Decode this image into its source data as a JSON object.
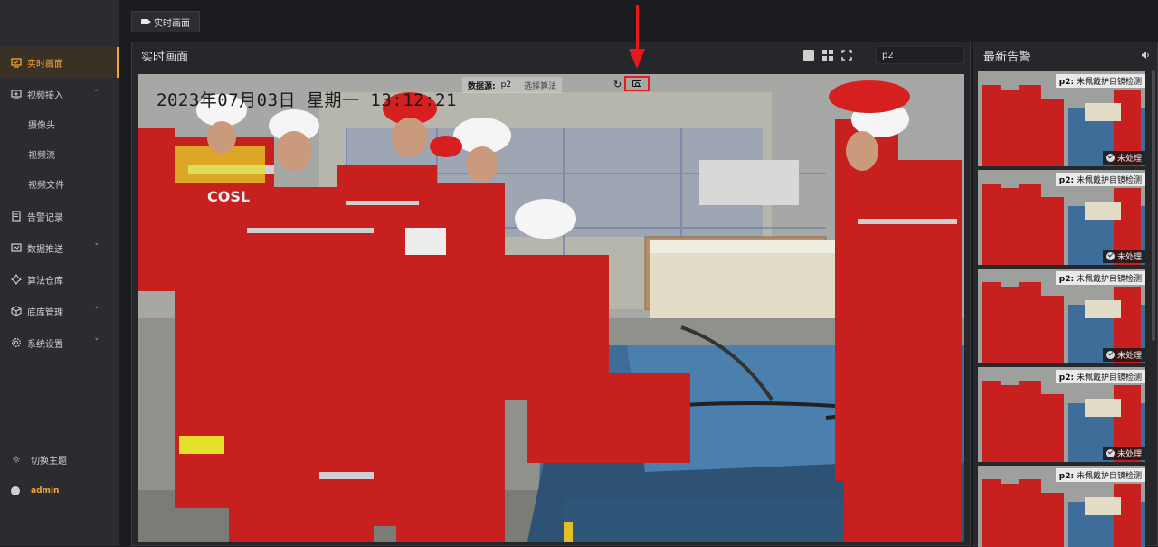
{
  "tab": {
    "label": "实时画面"
  },
  "sidebar": {
    "items": [
      {
        "label": "实时画面",
        "icon": "monitor-icon",
        "active": true
      },
      {
        "label": "视频接入",
        "icon": "video-input-icon",
        "chevron": "˄"
      },
      {
        "label": "告警记录",
        "icon": "alarm-record-icon"
      },
      {
        "label": "数据推送",
        "icon": "data-push-icon",
        "chevron": "˅"
      },
      {
        "label": "算法仓库",
        "icon": "algorithm-icon"
      },
      {
        "label": "底库管理",
        "icon": "library-icon",
        "chevron": "˅"
      },
      {
        "label": "系统设置",
        "icon": "settings-icon",
        "chevron": "˅"
      }
    ],
    "sub_items": [
      "摄像头",
      "视频流",
      "视频文件"
    ],
    "theme_label": "切换主题",
    "user": "admin"
  },
  "main": {
    "title": "实时画面",
    "channel": "p2",
    "overlay": {
      "source_label": "数据源:",
      "source_value": "p2",
      "algo_placeholder": "选择算法"
    },
    "timestamp": "2023年07月03日  星期一  13:12:21"
  },
  "alerts": {
    "title": "最新告警",
    "items": [
      {
        "camera": "p2:",
        "message": "未佩戴护目镜检测",
        "status": "未处理"
      },
      {
        "camera": "p2:",
        "message": "未佩戴护目镜检测",
        "status": "未处理"
      },
      {
        "camera": "p2:",
        "message": "未佩戴护目镜检测",
        "status": "未处理"
      },
      {
        "camera": "p2:",
        "message": "未佩戴护目镜检测",
        "status": "未处理"
      },
      {
        "camera": "p2:",
        "message": "未佩戴护目镜检测",
        "status": ""
      }
    ]
  },
  "colors": {
    "accent": "#f2a33a",
    "annotation": "#e8191a",
    "panel": "#26272b",
    "sidebar": "#2b2c30"
  }
}
